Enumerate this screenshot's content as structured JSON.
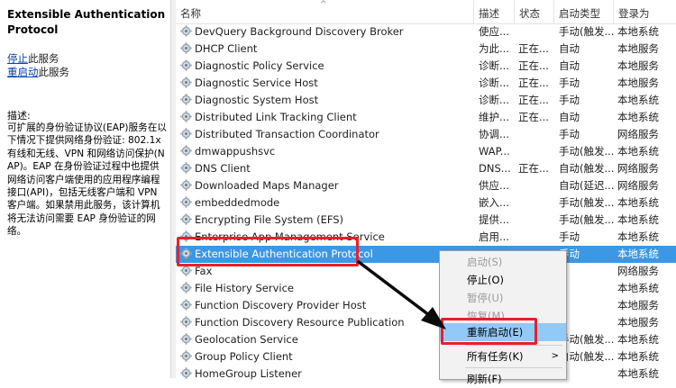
{
  "details": {
    "title": "Extensible Authentication Protocol",
    "stop_link": "停止",
    "stop_suffix": "此服务",
    "restart_link": "重启动",
    "restart_suffix": "此服务",
    "desc_label": "描述:",
    "description": "可扩展的身份验证协议(EAP)服务在以下情况下提供网络身份验证: 802.1x 有线和无线、VPN 和网络访问保护(NAP)。EAP 在身份验证过程中也提供网络访问客户端使用的应用程序编程接口(API)，包括无线客户端和 VPN 客户端。如果禁用此服务，该计算机将无法访问需要 EAP 身份验证的网络。"
  },
  "columns": {
    "name": "名称",
    "desc": "描述",
    "status": "状态",
    "startup": "启动类型",
    "logon": "登录为"
  },
  "services": [
    {
      "name": "DevQuery Background Discovery Broker",
      "desc": "使应...",
      "status": "",
      "startup": "手动(触发...",
      "logon": "本地系统"
    },
    {
      "name": "DHCP Client",
      "desc": "为此...",
      "status": "正在...",
      "startup": "自动",
      "logon": "本地服务"
    },
    {
      "name": "Diagnostic Policy Service",
      "desc": "诊断...",
      "status": "正在...",
      "startup": "自动",
      "logon": "本地服务"
    },
    {
      "name": "Diagnostic Service Host",
      "desc": "诊断...",
      "status": "正在...",
      "startup": "手动",
      "logon": "本地服务"
    },
    {
      "name": "Diagnostic System Host",
      "desc": "诊断...",
      "status": "正在...",
      "startup": "手动",
      "logon": "本地系统"
    },
    {
      "name": "Distributed Link Tracking Client",
      "desc": "维护...",
      "status": "正在...",
      "startup": "自动",
      "logon": "本地系统"
    },
    {
      "name": "Distributed Transaction Coordinator",
      "desc": "协调...",
      "status": "",
      "startup": "手动",
      "logon": "网络服务"
    },
    {
      "name": "dmwappushsvc",
      "desc": "WAP...",
      "status": "",
      "startup": "手动(触发...",
      "logon": "本地系统"
    },
    {
      "name": "DNS Client",
      "desc": "DNS...",
      "status": "正在...",
      "startup": "自动(触发...",
      "logon": "网络服务"
    },
    {
      "name": "Downloaded Maps Manager",
      "desc": "供应...",
      "status": "",
      "startup": "自动(延迟...",
      "logon": "网络服务"
    },
    {
      "name": "embeddedmode",
      "desc": "嵌入...",
      "status": "",
      "startup": "手动(触发...",
      "logon": "本地系统"
    },
    {
      "name": "Encrypting File System (EFS)",
      "desc": "提供...",
      "status": "",
      "startup": "手动(触发...",
      "logon": "本地系统"
    },
    {
      "name": "Enterprise App Management Service",
      "desc": "启用...",
      "status": "",
      "startup": "手动",
      "logon": "本地系统"
    },
    {
      "name": "Extensible Authentication Protocol",
      "desc": "",
      "status": "",
      "startup": "手动",
      "logon": "本地系统"
    },
    {
      "name": "Fax",
      "desc": "",
      "status": "",
      "startup": "",
      "logon": "网络服务"
    },
    {
      "name": "File History Service",
      "desc": "",
      "status": "",
      "startup": "",
      "logon": "本地系统"
    },
    {
      "name": "Function Discovery Provider Host",
      "desc": "",
      "status": "",
      "startup": "",
      "logon": "本地服务"
    },
    {
      "name": "Function Discovery Resource Publication",
      "desc": "",
      "status": "",
      "startup": "",
      "logon": "本地服务"
    },
    {
      "name": "Geolocation Service",
      "desc": "",
      "status": "",
      "startup": "手动(触发...",
      "logon": "本地系统"
    },
    {
      "name": "Group Policy Client",
      "desc": "",
      "status": "",
      "startup": "自动(触发...",
      "logon": "本地系统"
    },
    {
      "name": "HomeGroup Listener",
      "desc": "",
      "status": "",
      "startup": "",
      "logon": "本地系统"
    }
  ],
  "context_menu": {
    "items": [
      {
        "label": "启动(S)",
        "disabled": true
      },
      {
        "label": "停止(O)",
        "disabled": false
      },
      {
        "label": "暂停(U)",
        "disabled": true
      },
      {
        "label": "恢复(M)",
        "disabled": true
      },
      {
        "label": "重新启动(E)",
        "disabled": false
      },
      {
        "label": "所有任务(K)",
        "disabled": false
      },
      {
        "label": "刷新(F)",
        "disabled": false
      }
    ]
  },
  "colors": {
    "selection": "#3c97e4",
    "highlight_box": "#e8202a",
    "menu_hover": "#91c9f7",
    "link": "#0645ad"
  }
}
